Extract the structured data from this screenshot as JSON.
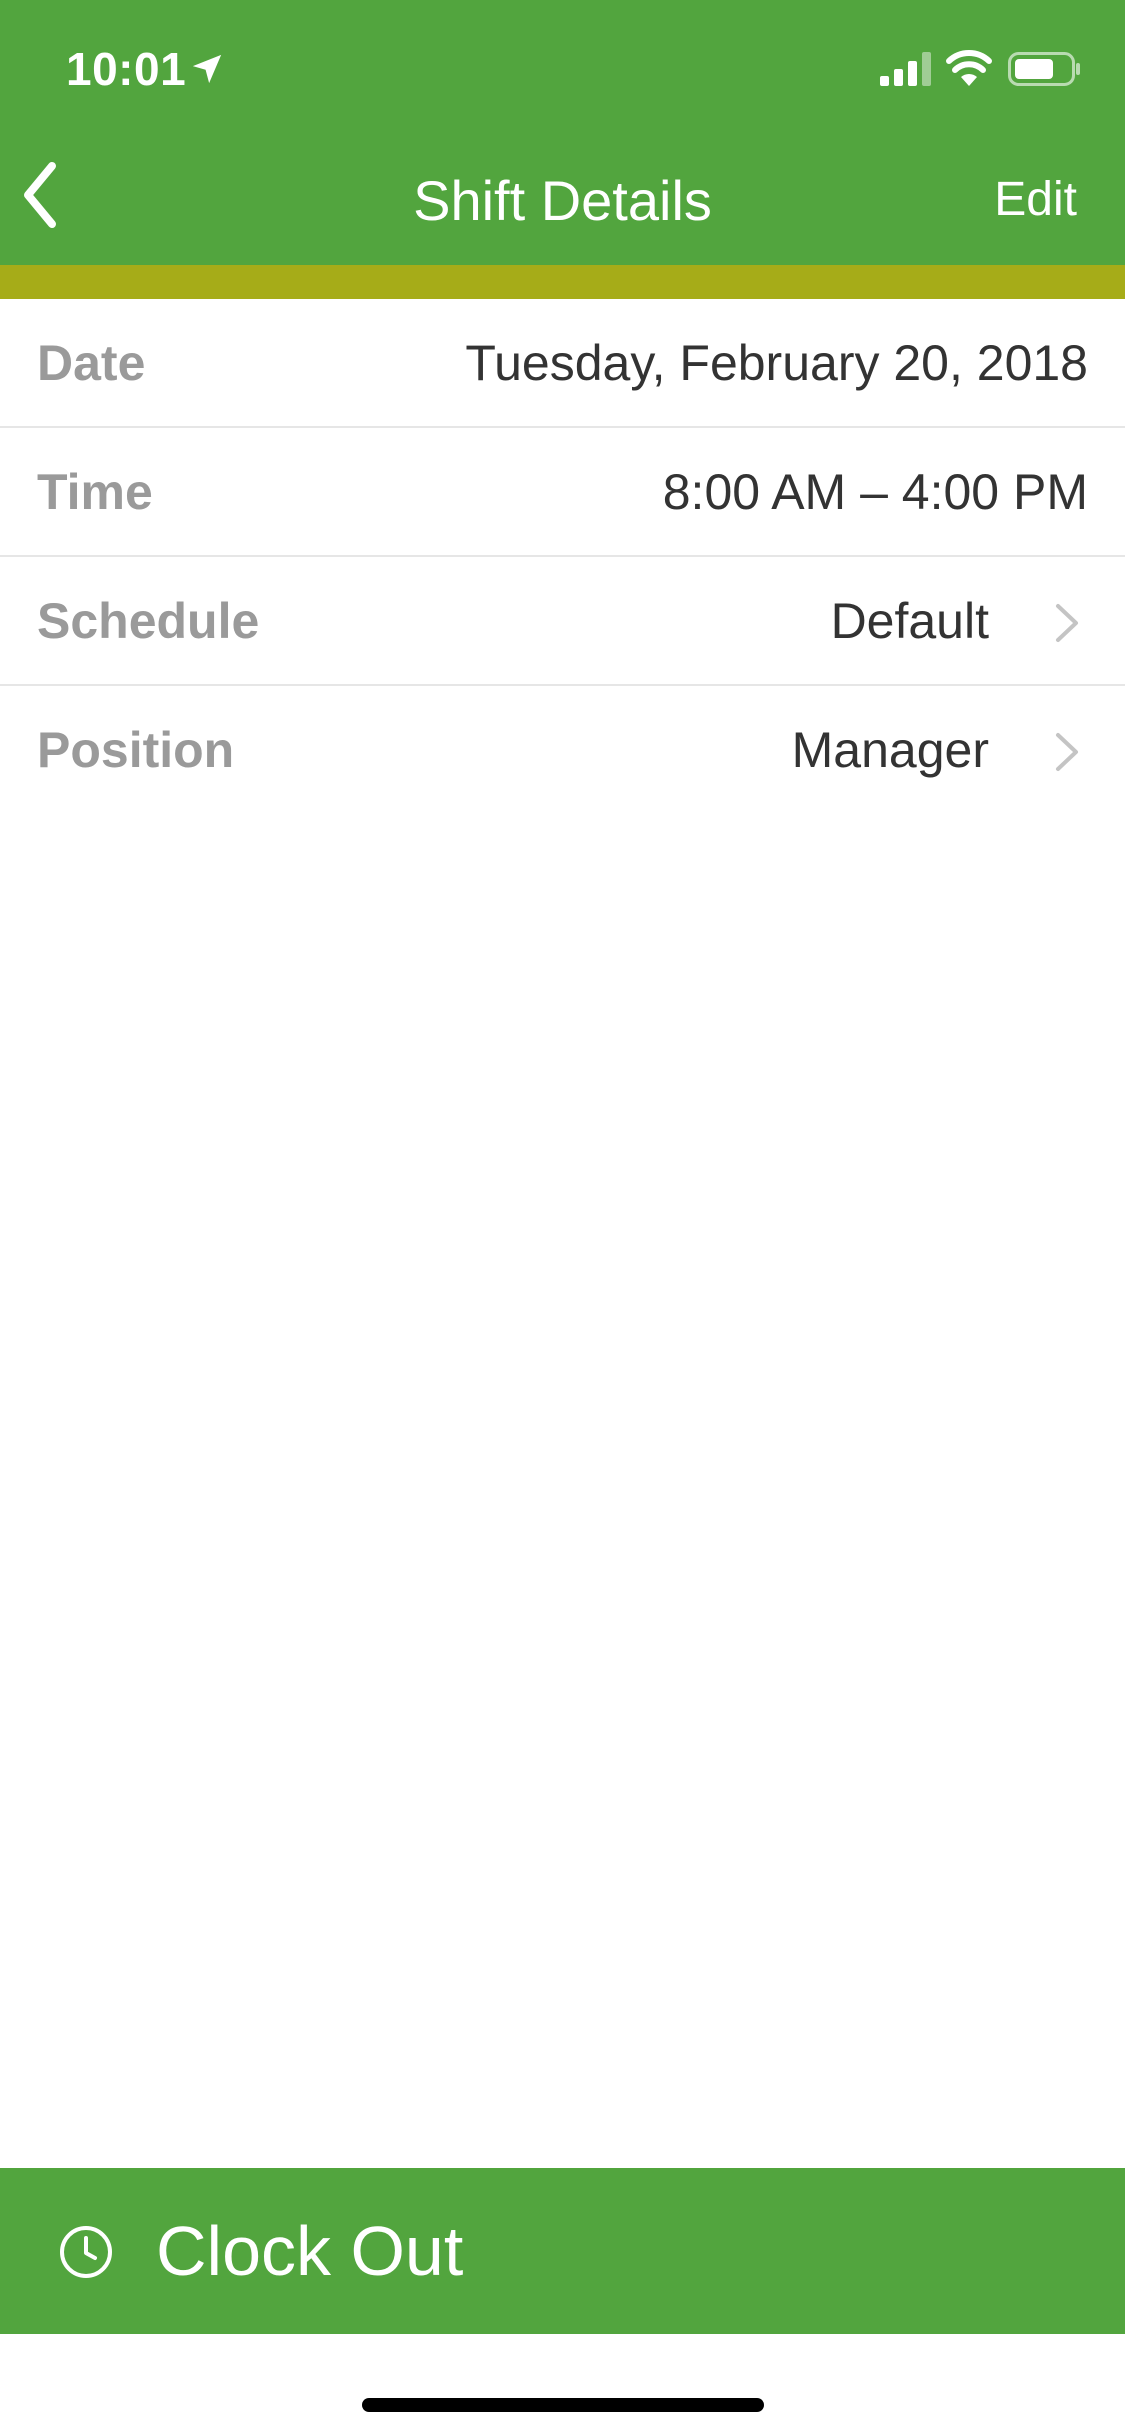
{
  "status_bar": {
    "time": "10:01",
    "icons": [
      "location-arrow-icon",
      "cellular-signal-icon",
      "wifi-icon",
      "battery-icon"
    ]
  },
  "nav": {
    "back_icon": "chevron-left-icon",
    "title": "Shift Details",
    "edit_label": "Edit"
  },
  "details": [
    {
      "label": "Date",
      "value": "Tuesday, February 20, 2018",
      "has_chevron": false
    },
    {
      "label": "Time",
      "value": "8:00 AM – 4:00 PM",
      "has_chevron": false
    },
    {
      "label": "Schedule",
      "value": "Default",
      "has_chevron": true
    },
    {
      "label": "Position",
      "value": "Manager",
      "has_chevron": true
    }
  ],
  "action": {
    "icon": "clock-icon",
    "label": "Clock Out"
  },
  "colors": {
    "header": "#52a53e",
    "accent_strip": "#a6ac18",
    "label_text": "#9a9a9a",
    "value_text": "#333333"
  }
}
